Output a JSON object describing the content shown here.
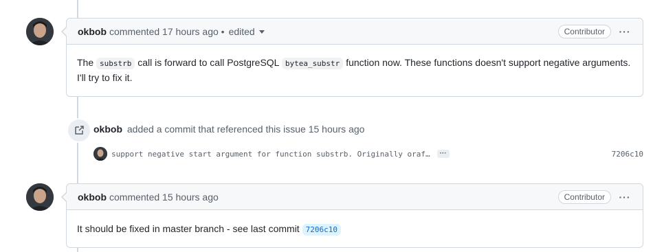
{
  "comment1": {
    "author": "okbob",
    "action": "commented",
    "time": "17 hours ago",
    "separator": "•",
    "edited": "edited",
    "badge": "Contributor",
    "more": "···",
    "body_p1": "The ",
    "code1": "substrb",
    "body_p2": " call is forward to call PostgreSQL ",
    "code2": "bytea_substr",
    "body_p3": " function now. These functions doesn't support negative arguments. I'll try to fix it."
  },
  "event": {
    "author": "okbob",
    "text": "added a commit that referenced this issue 15 hours ago",
    "icon": "cross-reference-icon"
  },
  "commit": {
    "message": "support negative start argument for function substrb. Originally oraf…",
    "expand": "···",
    "sha": "7206c10"
  },
  "comment2": {
    "author": "okbob",
    "action": "commented",
    "time": "15 hours ago",
    "badge": "Contributor",
    "more": "···",
    "body_text": "It should be fixed in master branch - see last commit ",
    "sha_link": "7206c10"
  },
  "colors": {
    "border": "#d0d7de",
    "header_bg": "#f6f8fa",
    "link": "#0969da",
    "muted": "#57606a"
  }
}
